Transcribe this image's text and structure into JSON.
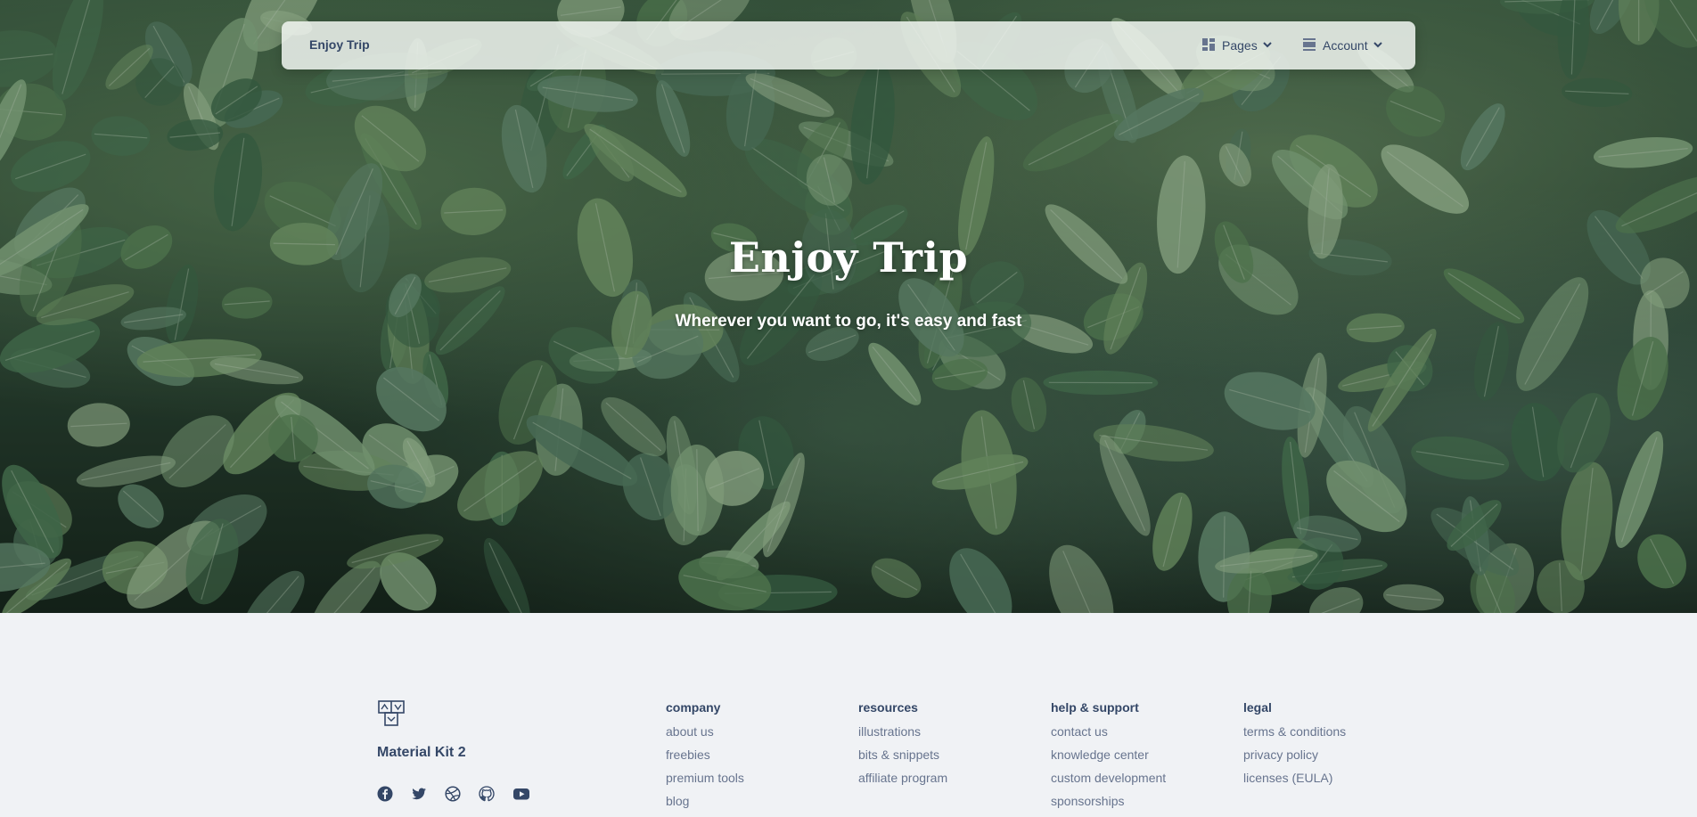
{
  "navbar": {
    "brand": "Enjoy Trip",
    "pages_label": "Pages",
    "account_label": "Account"
  },
  "hero": {
    "title": "Enjoy Trip",
    "subtitle": "Wherever you want to go, it's easy and fast"
  },
  "footer": {
    "brand": "Material Kit 2",
    "socials": [
      "facebook-icon",
      "twitter-icon",
      "dribbble-icon",
      "github-icon",
      "youtube-icon"
    ],
    "columns": [
      {
        "title": "company",
        "links": [
          "about us",
          "freebies",
          "premium tools",
          "blog"
        ]
      },
      {
        "title": "resources",
        "links": [
          "illustrations",
          "bits & snippets",
          "affiliate program"
        ]
      },
      {
        "title": "help & support",
        "links": [
          "contact us",
          "knowledge center",
          "custom development",
          "sponsorships"
        ]
      },
      {
        "title": "legal",
        "links": [
          "terms & conditions",
          "privacy policy",
          "licenses (EULA)"
        ]
      }
    ]
  },
  "colors": {
    "text_dark": "#344767",
    "text_muted": "#67748e",
    "page_bg": "#f0f2f5"
  }
}
